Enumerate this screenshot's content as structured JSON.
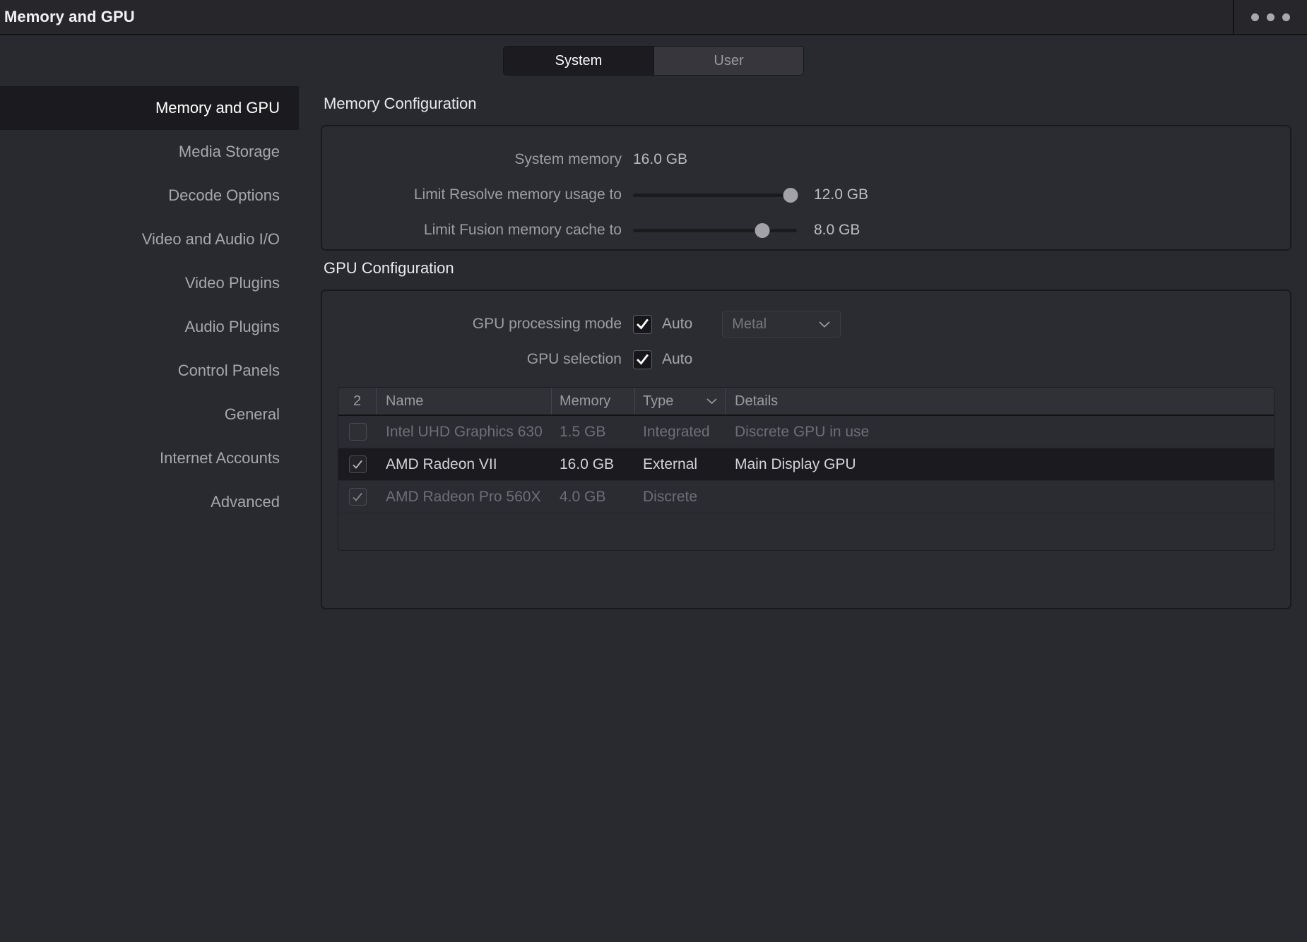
{
  "window": {
    "title": "Memory and GPU",
    "menu_icon": "ellipsis-icon"
  },
  "tabs": [
    {
      "label": "System",
      "active": true
    },
    {
      "label": "User",
      "active": false
    }
  ],
  "sidebar": {
    "items": [
      {
        "label": "Memory and GPU",
        "active": true
      },
      {
        "label": "Media Storage",
        "active": false
      },
      {
        "label": "Decode Options",
        "active": false
      },
      {
        "label": "Video and Audio I/O",
        "active": false
      },
      {
        "label": "Video Plugins",
        "active": false
      },
      {
        "label": "Audio Plugins",
        "active": false
      },
      {
        "label": "Control Panels",
        "active": false
      },
      {
        "label": "General",
        "active": false
      },
      {
        "label": "Internet Accounts",
        "active": false
      },
      {
        "label": "Advanced",
        "active": false
      }
    ]
  },
  "memory": {
    "section_title": "Memory Configuration",
    "system_memory_label": "System memory",
    "system_memory_value": "16.0 GB",
    "resolve_label": "Limit Resolve memory usage to",
    "resolve_value": "12.0 GB",
    "resolve_slider_percent": 96,
    "fusion_label": "Limit Fusion memory cache to",
    "fusion_value": "8.0 GB",
    "fusion_slider_percent": 79
  },
  "gpu": {
    "section_title": "GPU Configuration",
    "processing_mode_label": "GPU processing mode",
    "processing_mode_auto_label": "Auto",
    "processing_mode_auto_checked": true,
    "processing_mode_dropdown_value": "Metal",
    "selection_label": "GPU selection",
    "selection_auto_label": "Auto",
    "selection_auto_checked": true,
    "table": {
      "headers": {
        "count": "2",
        "name": "Name",
        "memory": "Memory",
        "type": "Type",
        "details": "Details",
        "sort_icon": "chevron-down-icon"
      },
      "rows": [
        {
          "checked": false,
          "selected": false,
          "name": "Intel UHD Graphics 630",
          "memory": "1.5 GB",
          "type": "Integrated",
          "details": "Discrete GPU in use"
        },
        {
          "checked": true,
          "selected": true,
          "name": "AMD Radeon VII",
          "memory": "16.0 GB",
          "type": "External",
          "details": "Main Display GPU"
        },
        {
          "checked": true,
          "selected": false,
          "name": "AMD Radeon Pro 560X",
          "memory": "4.0 GB",
          "type": "Discrete",
          "details": ""
        }
      ]
    }
  },
  "colors": {
    "window_bg": "#292a2f",
    "titlebar_bg": "#26262b",
    "panel_bg": "#2b2c31",
    "active_row_bg": "#1b1b1f",
    "text_primary": "#e9e9ec",
    "text_muted": "#9a9aa0"
  }
}
